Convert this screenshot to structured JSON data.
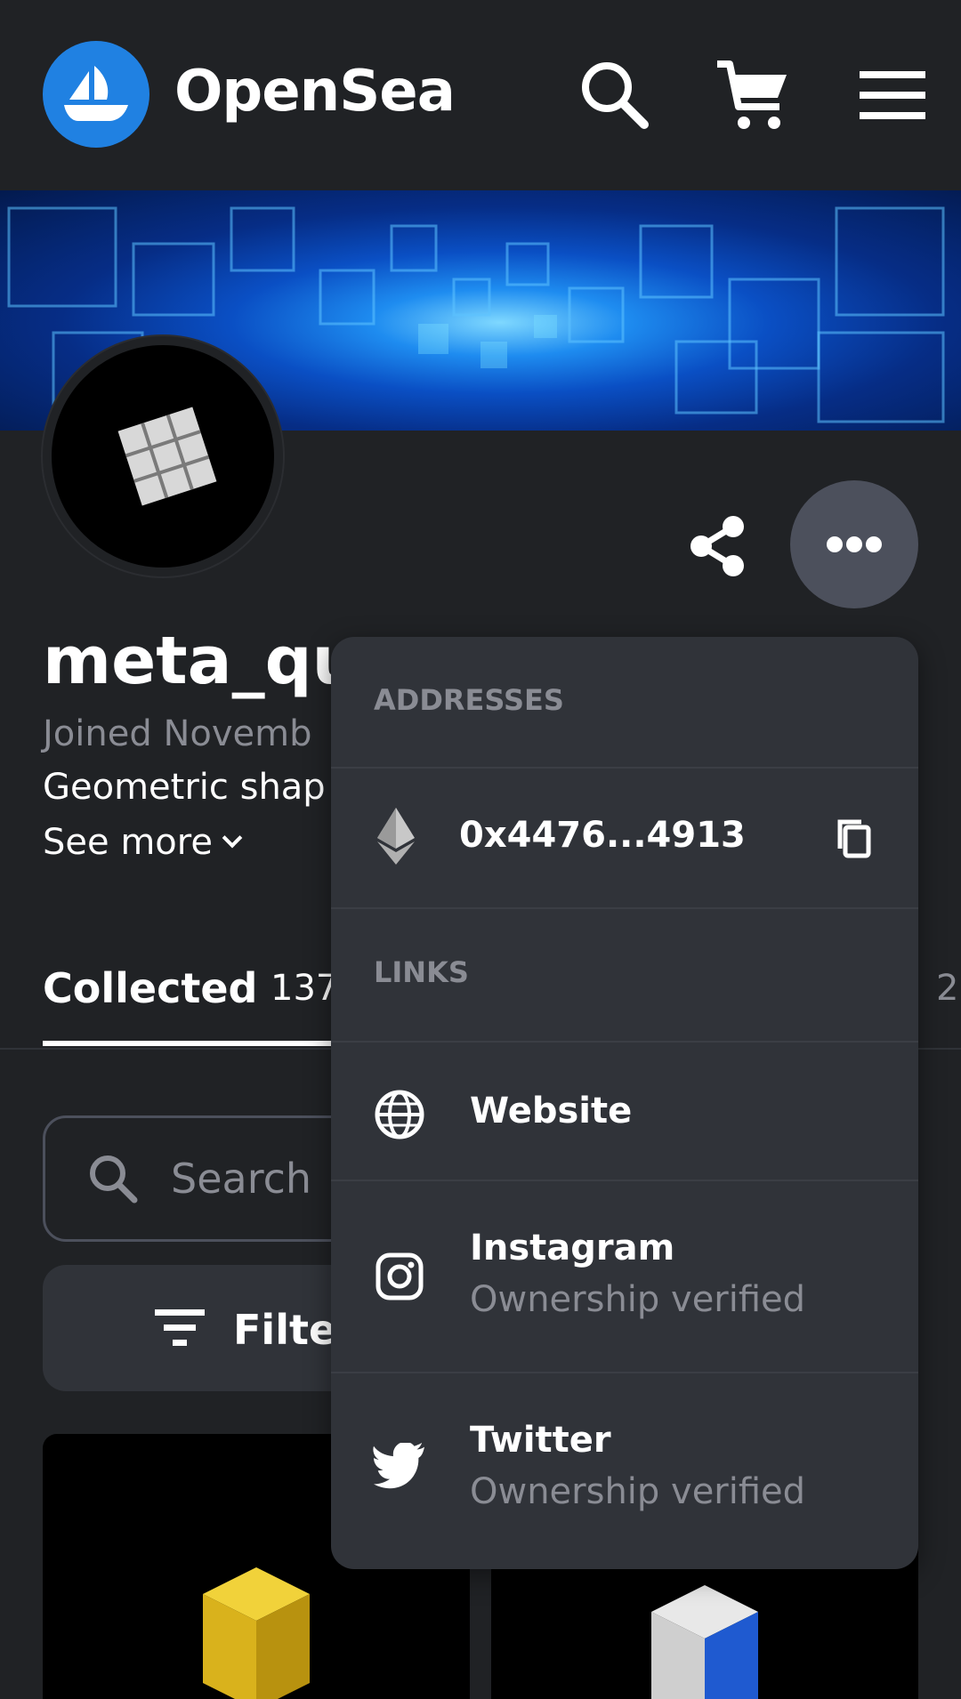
{
  "header": {
    "logo_text": "OpenSea",
    "icons": [
      "opensea-boat-icon",
      "search-icon",
      "cart-icon",
      "menu-icon"
    ]
  },
  "profile": {
    "username": "meta_qu",
    "joined": "Joined Novemb",
    "bio": "Geometric shap",
    "see_more": "See more",
    "actions": [
      "share-icon",
      "more-icon"
    ]
  },
  "tabs": {
    "collected_label": "Collected",
    "collected_count": "137",
    "other_count": "2"
  },
  "controls": {
    "search_placeholder": "Search",
    "filter_label": "Filter"
  },
  "dropdown": {
    "addresses_header": "ADDRESSES",
    "address": "0x4476...4913",
    "links_header": "LINKS",
    "links": [
      {
        "label": "Website",
        "icon": "globe-icon"
      },
      {
        "label": "Instagram",
        "sub": "Ownership verified",
        "icon": "instagram-icon"
      },
      {
        "label": "Twitter",
        "sub": "Ownership verified",
        "icon": "twitter-icon"
      }
    ]
  },
  "colors": {
    "brand_blue": "#2081e2",
    "background": "#202225",
    "panel": "#303339",
    "muted_text": "#8a8c94"
  }
}
